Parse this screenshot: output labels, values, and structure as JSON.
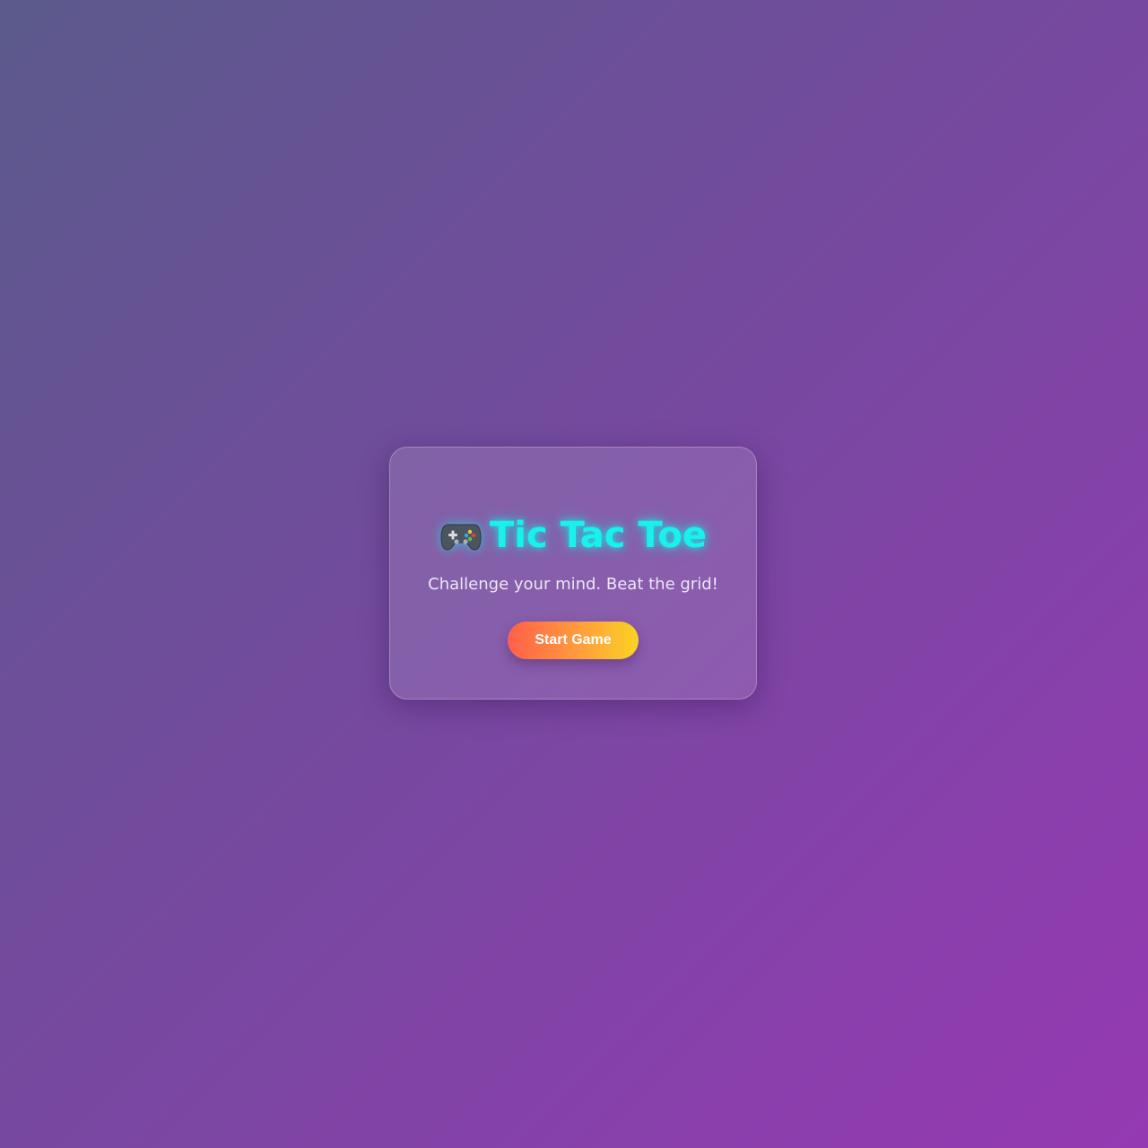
{
  "title": {
    "icon": "game-controller-icon",
    "text": "Tic Tac Toe"
  },
  "subtitle": "Challenge your mind. Beat the grid!",
  "start_button": {
    "label": "Start Game"
  },
  "colors": {
    "title_accent": "#19f2ec",
    "button_gradient_start": "#ff5f4b",
    "button_gradient_end": "#f9d423"
  }
}
